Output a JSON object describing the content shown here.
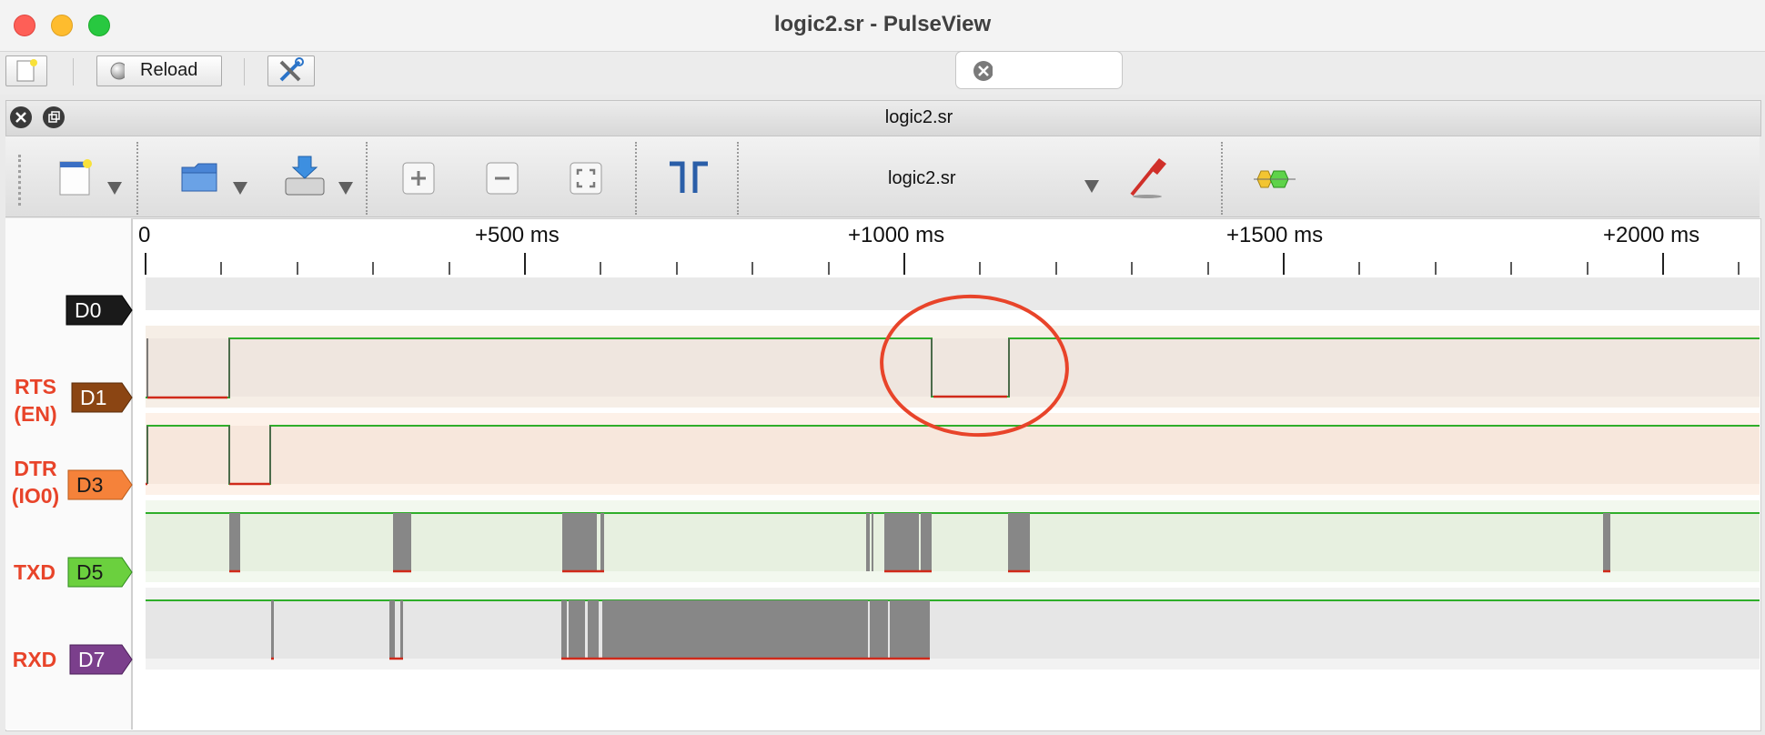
{
  "window": {
    "title": "logic2.sr - PulseView"
  },
  "toolbar": {
    "reload_label": "Reload",
    "search_placeholder": ""
  },
  "document": {
    "tab_title": "logic2.sr",
    "session_name": "logic2.sr"
  },
  "ruler": {
    "labels": [
      "0",
      "+500 ms",
      "+1000 ms",
      "+1500 ms",
      "+2000 ms"
    ]
  },
  "channels": [
    {
      "id": "D0",
      "name": "",
      "color": "#1a1a1a",
      "text_color": "#ffffff"
    },
    {
      "id": "D1",
      "name": "RTS\n(EN)",
      "color": "#8b4513",
      "text_color": "#ffffff"
    },
    {
      "id": "D3",
      "name": "DTR\n(IO0)",
      "color": "#f5823a",
      "text_color": "#1a1a1a"
    },
    {
      "id": "D5",
      "name": "TXD",
      "color": "#6bd03e",
      "text_color": "#1a1a1a"
    },
    {
      "id": "D7",
      "name": "RXD",
      "color": "#7b3f8c",
      "text_color": "#ffffff"
    }
  ],
  "colors": {
    "high_line": "#2fae2a",
    "low_line": "#d02a1a",
    "annotation_circle": "#e8442a",
    "busy_fill": "#878787"
  }
}
